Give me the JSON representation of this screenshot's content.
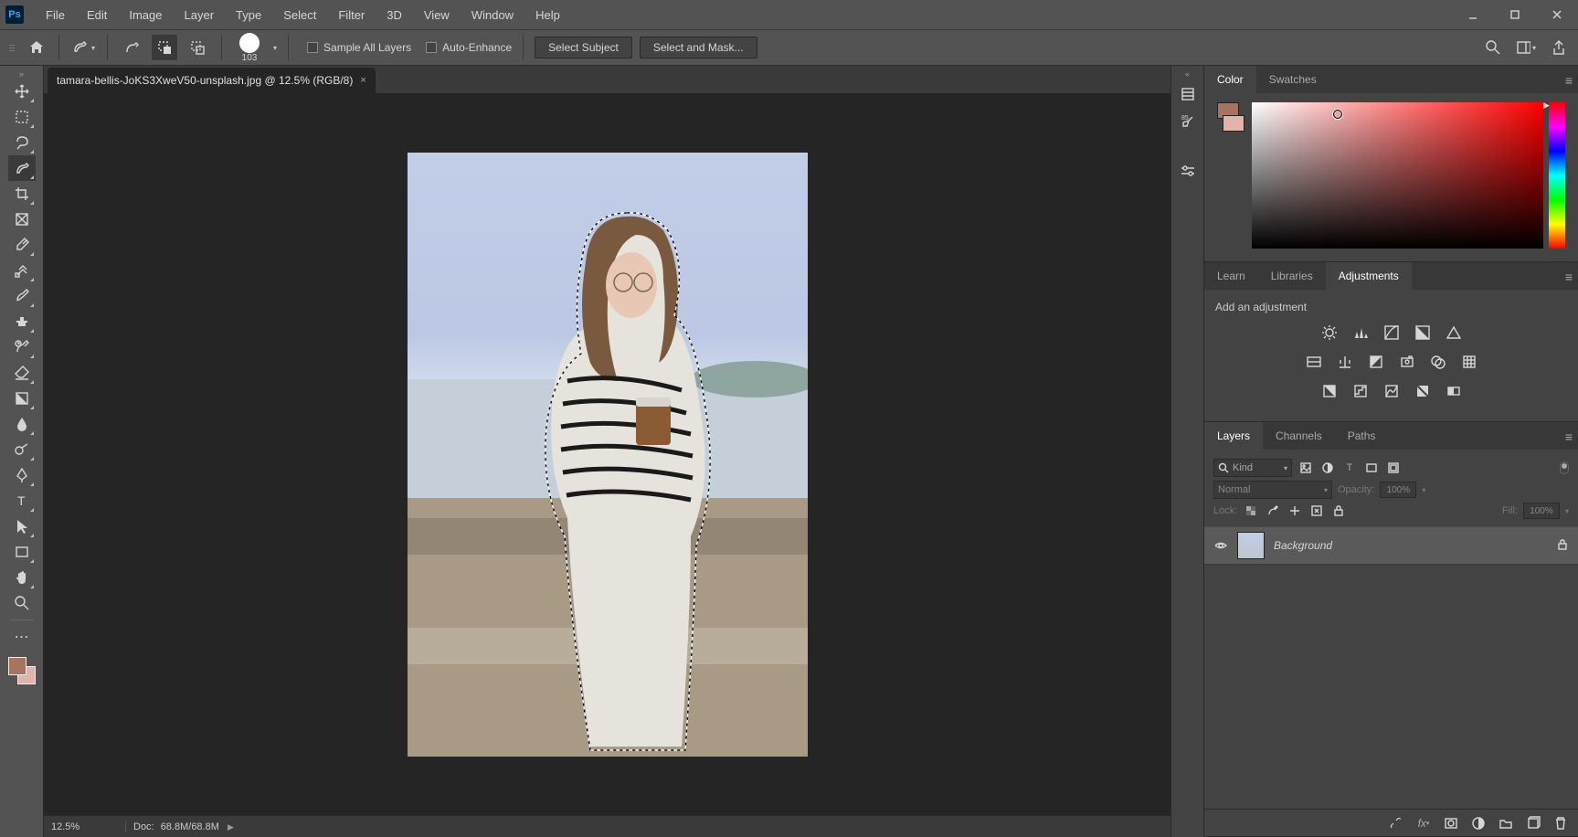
{
  "app": {
    "logo": "Ps"
  },
  "menus": [
    "File",
    "Edit",
    "Image",
    "Layer",
    "Type",
    "Select",
    "Filter",
    "3D",
    "View",
    "Window",
    "Help"
  ],
  "options": {
    "brush_size": "103",
    "sample_all": "Sample All Layers",
    "auto_enhance": "Auto-Enhance",
    "select_subject": "Select Subject",
    "select_mask": "Select and Mask..."
  },
  "document": {
    "tab_title": "tamara-bellis-JoKS3XweV50-unsplash.jpg @ 12.5% (RGB/8)",
    "zoom": "12.5%",
    "docsize_label": "Doc:",
    "docsize": "68.8M/68.8M"
  },
  "panels": {
    "color_tabs": [
      "Color",
      "Swatches"
    ],
    "learn_tabs": [
      "Learn",
      "Libraries",
      "Adjustments"
    ],
    "adjust_label": "Add an adjustment",
    "layers_tabs": [
      "Layers",
      "Channels",
      "Paths"
    ],
    "kind_label": "Kind",
    "blend_mode": "Normal",
    "opacity_label": "Opacity:",
    "opacity": "100%",
    "lock_label": "Lock:",
    "fill_label": "Fill:",
    "fill": "100%",
    "layer_name": "Background"
  },
  "colors": {
    "foreground": "#a87460",
    "background_swatch": "#e3b2a8"
  }
}
